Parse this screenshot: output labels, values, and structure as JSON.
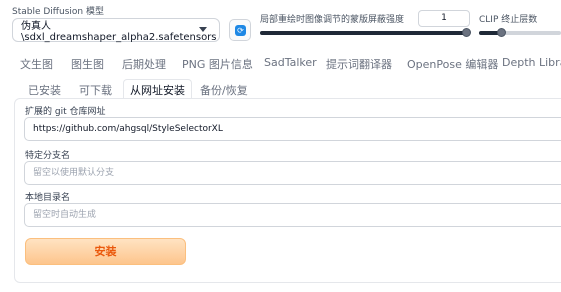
{
  "checkpoint": {
    "label": "Stable Diffusion 模型",
    "value": "伪真人\\sdxl_dreamshaper_alpha2.safetensors"
  },
  "inpaint_strength": {
    "label": "局部重绘时图像调节的蒙版屏蔽强度",
    "value": "1",
    "level": 1.0
  },
  "clip_skip": {
    "label": "CLIP 终止层数",
    "level": 0.08
  },
  "main_tabs": [
    "文生图",
    "图生图",
    "后期处理",
    "PNG 图片信息",
    "SadTalker",
    "提示词翻译器",
    "OpenPose 编辑器",
    "Depth Library"
  ],
  "sub_tabs": [
    "已安装",
    "可下载",
    "从网址安装",
    "备份/恢复"
  ],
  "active_sub_tab": "从网址安装",
  "form": {
    "git_url": {
      "label": "扩展的 git 仓库网址",
      "value": "https://github.com/ahgsql/StyleSelectorXL"
    },
    "branch": {
      "label": "特定分支名",
      "placeholder": "留空以使用默认分支"
    },
    "local_dir": {
      "label": "本地目录名",
      "placeholder": "留空时自动生成"
    },
    "install_label": "安装"
  },
  "colors": {
    "accent": "#ea580c",
    "refresh": "#1e88e5"
  },
  "icons": {
    "refresh": "refresh-icon",
    "dropdown": "chevron-down-icon"
  }
}
